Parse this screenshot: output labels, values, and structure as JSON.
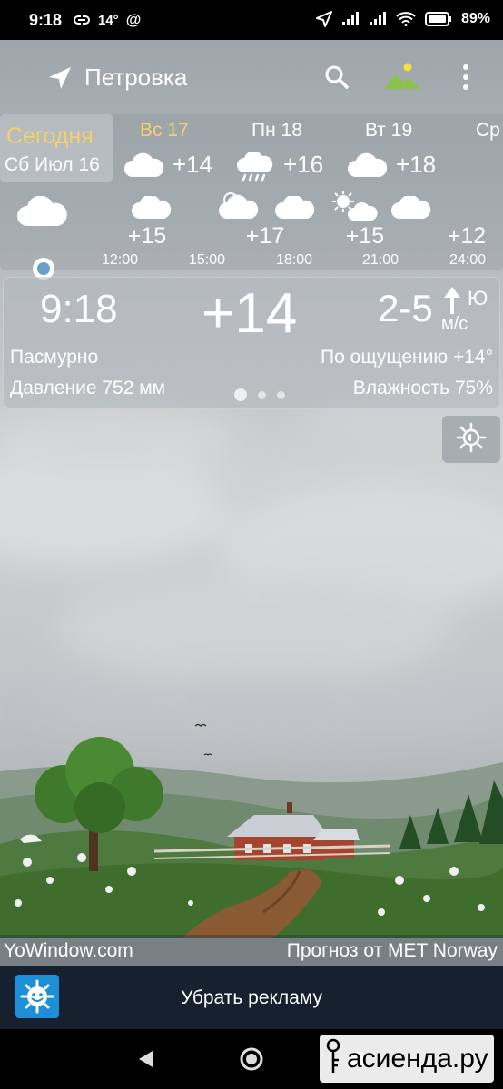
{
  "status_bar": {
    "time": "9:18",
    "temp_badge": "14°",
    "battery": "89%"
  },
  "header": {
    "location": "Петровка",
    "icons": [
      "location-arrow-icon",
      "search-icon",
      "landscape-icon",
      "more-vert-icon"
    ]
  },
  "forecast": {
    "today": {
      "label": "Сегодня",
      "date": "Сб Июл 16"
    },
    "days": [
      {
        "name": "Вс 17",
        "temp": "+14",
        "icon": "cloud-icon",
        "highlight": true
      },
      {
        "name": "Пн 18",
        "temp": "+16",
        "icon": "rain-cloud-icon",
        "highlight": false
      },
      {
        "name": "Вт 19",
        "temp": "+18",
        "icon": "cloud-icon",
        "highlight": false
      },
      {
        "name": "Ср",
        "temp": "",
        "icon": "cloud-icon",
        "highlight": false
      }
    ],
    "hours": [
      {
        "time": "12:00",
        "temp": "+15",
        "icon": "cloud-icon"
      },
      {
        "time": "15:00",
        "temp": "",
        "icon": "partly-cloudy-icon"
      },
      {
        "time": "18:00",
        "temp": "+17",
        "icon": "cloud-icon"
      },
      {
        "time": "21:00",
        "temp": "+15",
        "icon": "sun-cloud-icon"
      },
      {
        "time": "24:00",
        "temp": "+12",
        "icon": "cloud-icon"
      }
    ]
  },
  "current": {
    "time": "9:18",
    "temp": "+14",
    "wind_speed": "2-5",
    "wind_dir": "Ю",
    "wind_unit": "м/с",
    "condition": "Пасмурно",
    "feels_like": "По ощущению +14°",
    "pressure": "Давление 752 мм",
    "humidity": "Влажность 75%"
  },
  "footer": {
    "brand": "YoWindow.com",
    "source": "Прогноз от MET Norway"
  },
  "ad": {
    "remove_ads": "Убрать рекламу"
  },
  "watermark": {
    "text": "асиенда.ру"
  },
  "colors": {
    "today_accent": "#f7d06c",
    "ad_background": "#16202e",
    "app_icon": "#1d8fd8",
    "now_dot": "#6aa0c8"
  }
}
